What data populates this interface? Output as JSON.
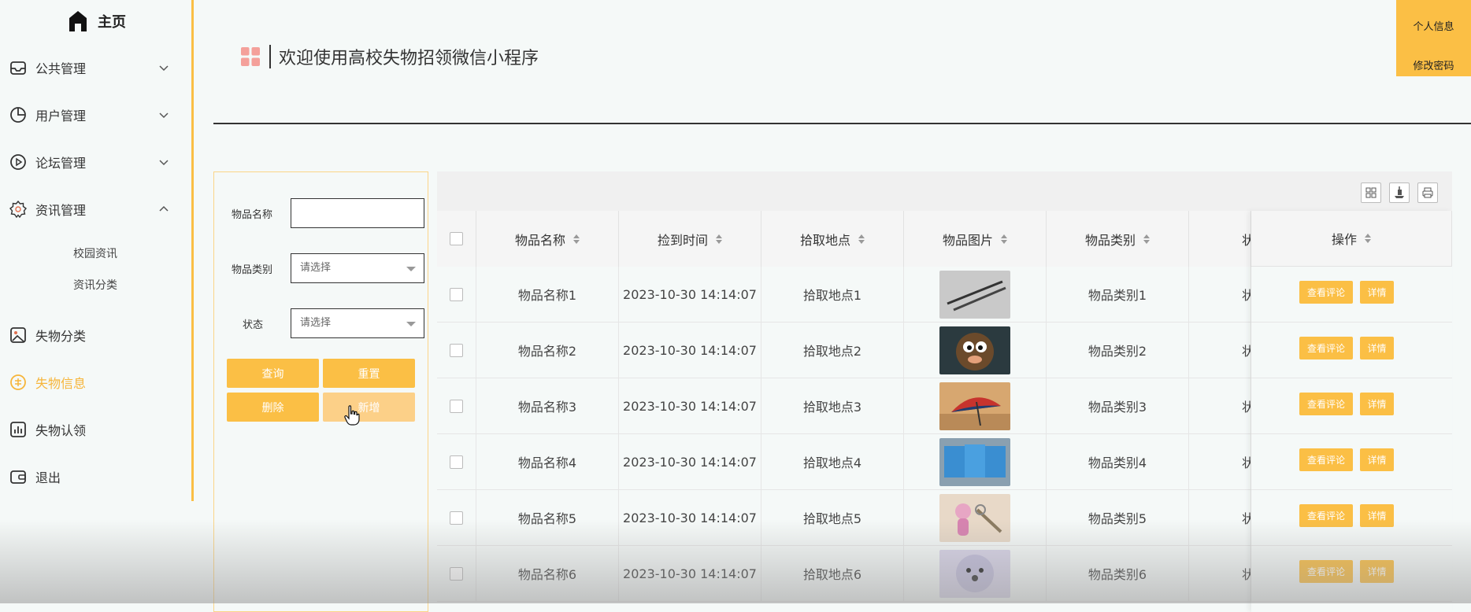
{
  "sidebar": {
    "home_label": "主页",
    "items": [
      {
        "label": "公共管理",
        "icon": "inbox-icon",
        "expanded": false
      },
      {
        "label": "用户管理",
        "icon": "pie-chart-icon",
        "expanded": false
      },
      {
        "label": "论坛管理",
        "icon": "play-circle-icon",
        "expanded": false
      },
      {
        "label": "资讯管理",
        "icon": "badge-icon",
        "expanded": true
      },
      {
        "label": "失物分类",
        "icon": "picture-icon"
      },
      {
        "label": "失物信息",
        "icon": "star-circle-icon",
        "active": true
      },
      {
        "label": "失物认领",
        "icon": "bar-chart-icon"
      },
      {
        "label": "退出",
        "icon": "wallet-icon"
      }
    ],
    "subitems": [
      "校园资讯",
      "资讯分类"
    ]
  },
  "header": {
    "title": "欢迎使用高校失物招领微信小程序",
    "profile_label": "个人信息",
    "change_password_label": "修改密码"
  },
  "filter": {
    "name_label": "物品名称",
    "name_value": "",
    "category_label": "物品类别",
    "category_placeholder": "请选择",
    "status_label": "状态",
    "status_placeholder": "请选择",
    "search_btn": "查询",
    "reset_btn": "重置",
    "delete_btn": "删除",
    "add_btn": "新增"
  },
  "table": {
    "columns": [
      "物品名称",
      "捡到时间",
      "拾取地点",
      "物品图片",
      "物品类别",
      "状",
      "操作"
    ],
    "rows": [
      {
        "name": "物品名称1",
        "time": "2023-10-30 14:14:07",
        "place": "拾取地点1",
        "category": "物品类别1",
        "status": "状"
      },
      {
        "name": "物品名称2",
        "time": "2023-10-30 14:14:07",
        "place": "拾取地点2",
        "category": "物品类别2",
        "status": "状"
      },
      {
        "name": "物品名称3",
        "time": "2023-10-30 14:14:07",
        "place": "拾取地点3",
        "category": "物品类别3",
        "status": "状"
      },
      {
        "name": "物品名称4",
        "time": "2023-10-30 14:14:07",
        "place": "拾取地点4",
        "category": "物品类别4",
        "status": "状"
      },
      {
        "name": "物品名称5",
        "time": "2023-10-30 14:14:07",
        "place": "拾取地点5",
        "category": "物品类别5",
        "status": "状"
      },
      {
        "name": "物品名称6",
        "time": "2023-10-30 14:14:07",
        "place": "拾取地点6",
        "category": "物品类别6",
        "status": "状"
      }
    ],
    "comment_btn": "查看评论",
    "detail_btn": "详情"
  },
  "colors": {
    "accent": "#fbbf45",
    "accent_light": "#fcd088",
    "background": "#f5f9f8"
  }
}
